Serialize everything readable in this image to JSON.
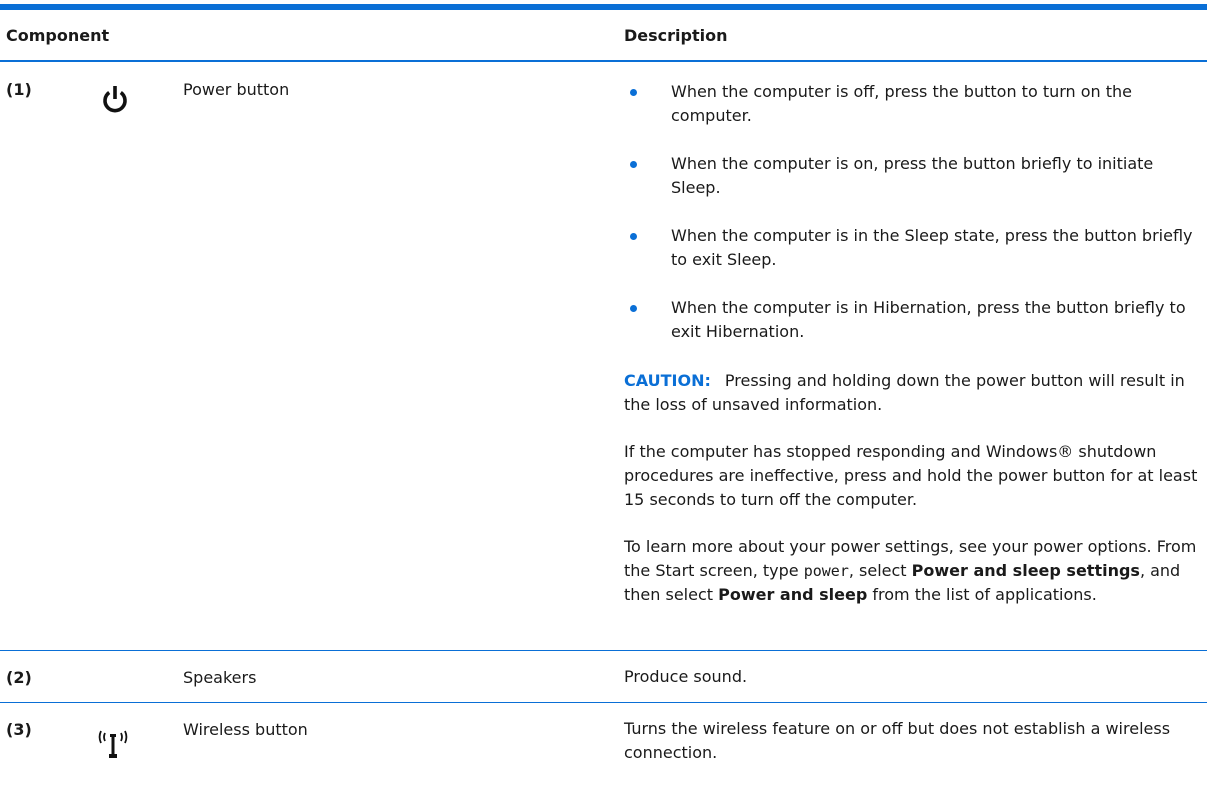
{
  "header": {
    "component": "Component",
    "description": "Description"
  },
  "rows": [
    {
      "number": "(1)",
      "name": "Power button",
      "icon": "power-icon",
      "bullets": [
        "When the computer is off, press the button to turn on the computer.",
        "When the computer is on, press the button briefly to initiate Sleep.",
        "When the computer is in the Sleep state, press the button briefly to exit Sleep.",
        "When the computer is in Hibernation, press the button briefly to exit Hibernation."
      ],
      "caution_label": "CAUTION:",
      "caution_text": "Pressing and holding down the power button will result in the loss of unsaved information.",
      "paragraph_1": "If the computer has stopped responding and Windows® shutdown procedures are ineffective, press and hold the power button for at least 15 seconds to turn off the computer.",
      "paragraph_2": {
        "part_1": "To learn more about your power settings, see your power options. From the Start screen, type ",
        "code": "power",
        "part_2": ", select ",
        "bold_1": "Power and sleep settings",
        "part_3": ", and then select ",
        "bold_2": "Power and sleep",
        "part_4": " from the list of applications."
      }
    },
    {
      "number": "(2)",
      "name": "Speakers",
      "description": "Produce sound."
    },
    {
      "number": "(3)",
      "name": "Wireless button",
      "icon": "wireless-icon",
      "description": "Turns the wireless feature on or off but does not establish a wireless connection."
    }
  ],
  "colors": {
    "accent": "#0a6fd6"
  }
}
